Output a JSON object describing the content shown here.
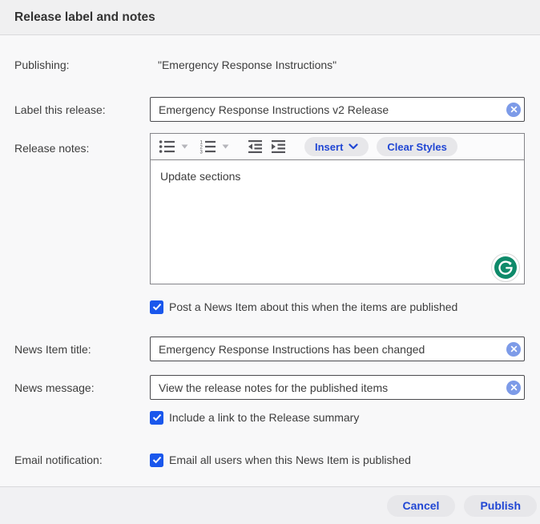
{
  "title": "Release label and notes",
  "colors": {
    "checkbox_blue": "#1a57ec",
    "button_text_blue": "#2046d4",
    "pill_bg": "#e7e7ea",
    "clear_icon_blue": "#7d9be8",
    "grammarly_green": "#0f8a6a"
  },
  "rows": {
    "publishing": {
      "label": "Publishing:",
      "value": "\"Emergency Response Instructions\""
    },
    "release_label": {
      "label": "Label this release:",
      "value": "Emergency Response Instructions v2 Release"
    },
    "release_notes": {
      "label": "Release notes:",
      "content": "Update sections"
    },
    "news_item_title": {
      "label": "News Item title:",
      "value": "Emergency Response Instructions has been changed"
    },
    "news_message": {
      "label": "News message:",
      "value": "View the release notes for the published items"
    },
    "email_notification": {
      "label": "Email notification:"
    }
  },
  "editor_toolbar": {
    "insert_label": "Insert",
    "clear_styles_label": "Clear Styles",
    "icons": [
      "unordered-list-icon",
      "chevron-down-icon",
      "ordered-list-icon",
      "chevron-down-icon",
      "outdent-icon",
      "indent-icon"
    ]
  },
  "checkboxes": {
    "post_news_item": {
      "label": "Post a News Item about this when the items are published",
      "checked": true
    },
    "include_link": {
      "label": "Include a link to the Release summary",
      "checked": true
    },
    "email_all_users": {
      "label": "Email all users when this News Item is published",
      "checked": true
    }
  },
  "editor_badge": "grammarly-icon",
  "footer": {
    "cancel_label": "Cancel",
    "publish_label": "Publish"
  }
}
